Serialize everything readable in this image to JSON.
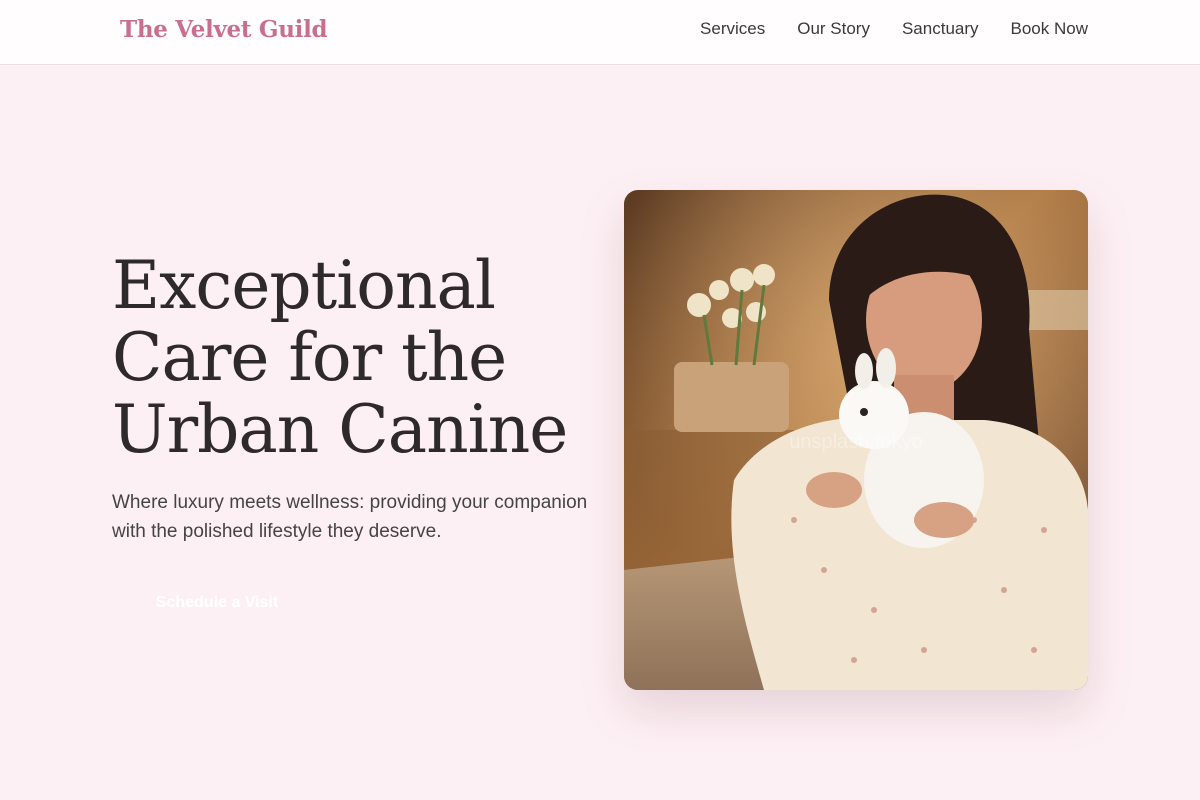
{
  "header": {
    "logo": "The Velvet Guild",
    "nav": [
      {
        "label": "Services"
      },
      {
        "label": "Our Story"
      },
      {
        "label": "Sanctuary"
      },
      {
        "label": "Book Now"
      }
    ]
  },
  "hero": {
    "title": "Exceptional Care for the Urban Canine",
    "subtitle": "Where luxury meets wellness: providing your companion with the polished lifestyle they deserve.",
    "cta_label": "Schedule a Visit",
    "photo_watermark": "unsplash.tokyo"
  },
  "colors": {
    "page_bg": "#fdf0f4",
    "logo": "#c86e8f",
    "text": "#2e2a2b"
  }
}
